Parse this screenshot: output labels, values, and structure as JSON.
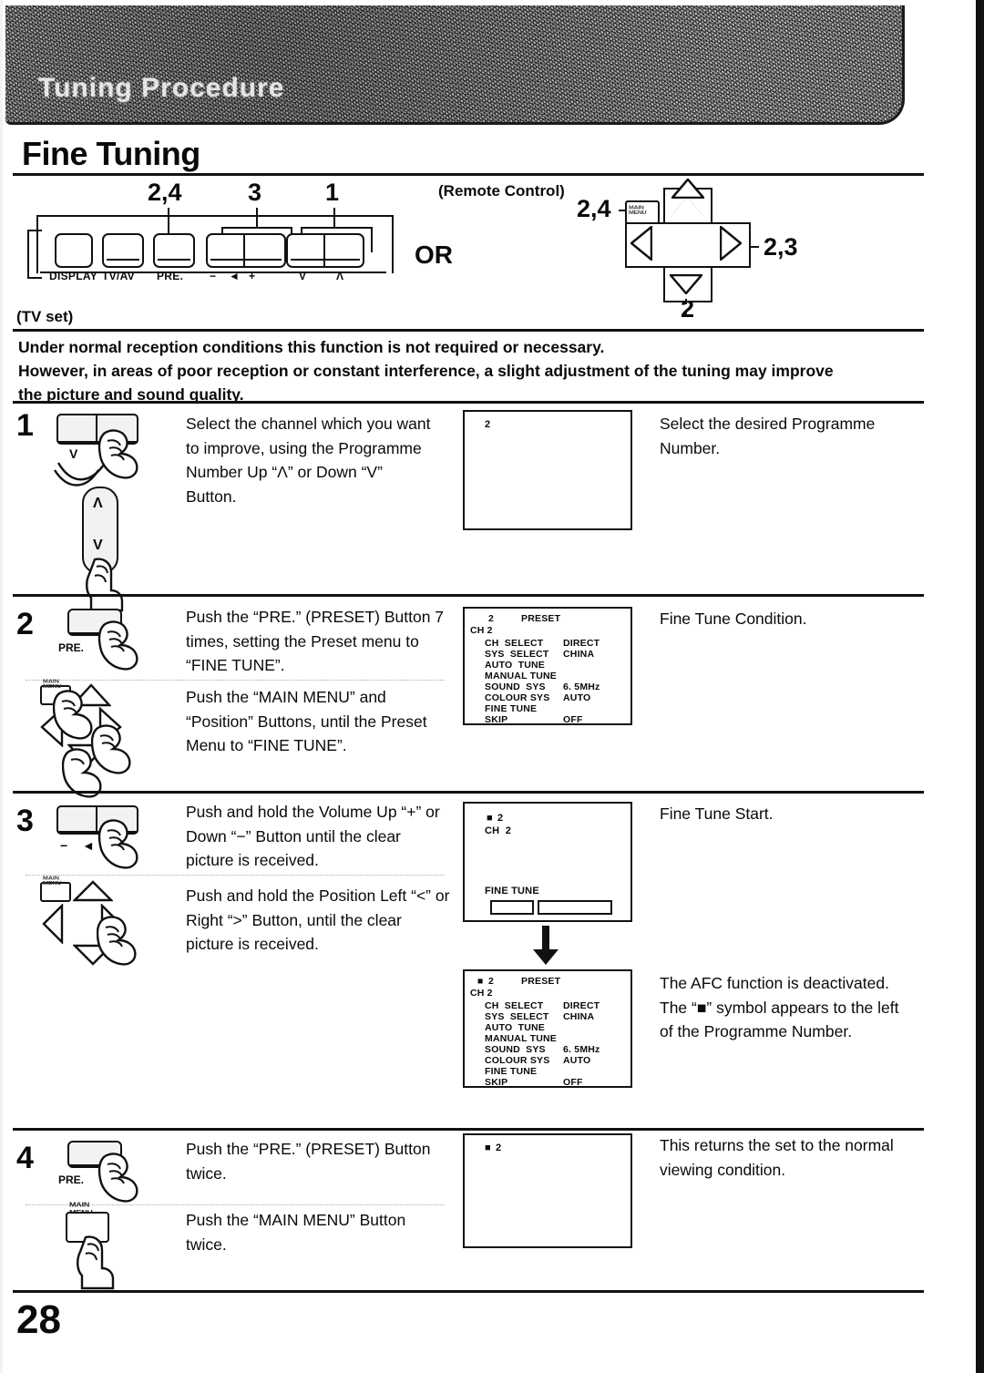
{
  "document": {
    "header_band_title": "Tuning Procedure",
    "page_title": "Fine Tuning",
    "page_number": "28"
  },
  "diagram": {
    "tv_set_label": "(TV set)",
    "remote_label": "(Remote Control)",
    "or_label": "OR",
    "tv_callouts": [
      "2,4",
      "3",
      "1"
    ],
    "remote_callouts": {
      "main_menu": "2,4",
      "right": "2,3",
      "down": "2"
    },
    "tv_buttons": [
      {
        "label": "DISPLAY"
      },
      {
        "label": "TV/AV"
      },
      {
        "label": "PRE."
      },
      {
        "label": "−  ◄  +"
      },
      {
        "label": "V      Λ"
      }
    ],
    "tv_button_labels": {
      "display": "DISPLAY",
      "tvav": "TV/AV",
      "pre": "PRE.",
      "minus": "−",
      "volume_icon": "◄",
      "plus": "+",
      "down": "V",
      "up": "Λ"
    },
    "remote_main_menu_cap": "MAIN MENU"
  },
  "intro": {
    "line1": "Under normal reception conditions this function is not required or necessary.",
    "line2": "However, in areas of poor reception or constant interference, a slight adjustment of the tuning may improve",
    "line3": "the picture and sound quality."
  },
  "steps": [
    {
      "number": "1",
      "instructions": [
        "Select the channel which you want to improve, using the Programme Number Up “Λ” or Down “V” Button."
      ],
      "icon_labels": {
        "down": "V",
        "up": "Λ",
        "remote_up": "Λ",
        "remote_down": "V"
      },
      "osd": {
        "type": "blank",
        "programme": "2"
      },
      "results": [
        "Select the desired Programme Number."
      ]
    },
    {
      "number": "2",
      "instructions": [
        "Push the “PRE.” (PRESET) Button 7 times, setting the Preset menu to “FINE TUNE”.",
        "Push the “MAIN MENU” and “Position” Buttons, until the Preset Menu to “FINE TUNE”."
      ],
      "icon_labels": {
        "pre": "PRE.",
        "main_menu": "MAIN MENU"
      },
      "osd": {
        "type": "preset-menu",
        "marker": "",
        "programme": "2",
        "title": "PRESET",
        "channel": "CH 2",
        "rows": [
          {
            "name": "CH  SELECT",
            "value": "DIRECT"
          },
          {
            "name": "SYS  SELECT",
            "value": "CHINA"
          },
          {
            "name": "AUTO  TUNE",
            "value": ""
          },
          {
            "name": "MANUAL TUNE",
            "value": ""
          },
          {
            "name": "SOUND  SYS",
            "value": "6. 5MHz"
          },
          {
            "name": "COLOUR SYS",
            "value": "AUTO"
          },
          {
            "name": "FINE TUNE",
            "value": ""
          },
          {
            "name": "SKIP",
            "value": "OFF"
          }
        ]
      },
      "results": [
        "Fine Tune Condition."
      ]
    },
    {
      "number": "3",
      "instructions": [
        "Push and hold the Volume Up “+” or Down “−” Button until the clear picture is received.",
        "Push and hold the Position Left “<” or Right “>” Button, until the clear picture is received."
      ],
      "icon_labels": {
        "minus": "−",
        "volume_icon": "◄",
        "plus": "+",
        "main_menu": "MAIN MENU"
      },
      "osd": {
        "type": "fine-tune",
        "marker": "■",
        "programme": "2",
        "channel": "CH  2",
        "caption": "FINE TUNE"
      },
      "osd2": {
        "type": "preset-menu",
        "marker": "■",
        "programme": "2",
        "title": "PRESET",
        "channel": "CH 2",
        "rows": [
          {
            "name": "CH  SELECT",
            "value": "DIRECT"
          },
          {
            "name": "SYS  SELECT",
            "value": "CHINA"
          },
          {
            "name": "AUTO  TUNE",
            "value": ""
          },
          {
            "name": "MANUAL TUNE",
            "value": ""
          },
          {
            "name": "SOUND  SYS",
            "value": "6. 5MHz"
          },
          {
            "name": "COLOUR SYS",
            "value": "AUTO"
          },
          {
            "name": "FINE TUNE",
            "value": ""
          },
          {
            "name": "SKIP",
            "value": "OFF"
          }
        ]
      },
      "results": [
        "Fine Tune Start.",
        "The AFC function is deactivated.\nThe “■” symbol appears to the left of the Programme Number."
      ]
    },
    {
      "number": "4",
      "instructions": [
        "Push the “PRE.” (PRESET) Button twice.",
        "Push the “MAIN MENU” Button twice."
      ],
      "icon_labels": {
        "pre": "PRE.",
        "main_menu": "MAIN MENU"
      },
      "osd": {
        "type": "blank-marked",
        "marker": "■",
        "programme": "2"
      },
      "results": [
        "This returns the set to the normal viewing condition."
      ]
    }
  ]
}
